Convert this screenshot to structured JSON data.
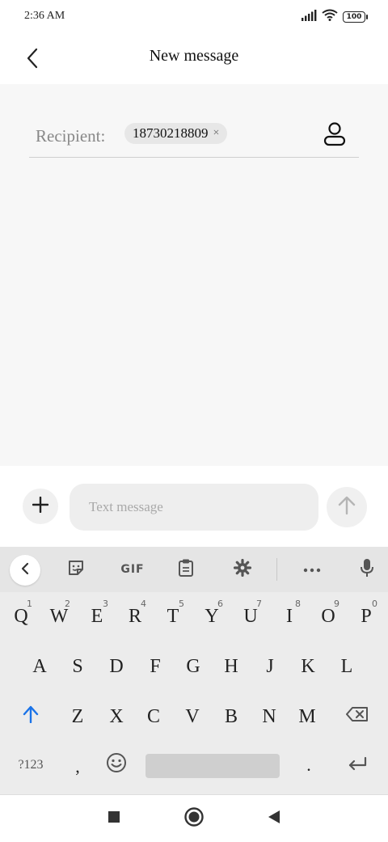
{
  "status_bar": {
    "time": "2:36 AM",
    "battery": "100"
  },
  "header": {
    "title": "New message"
  },
  "recipient": {
    "label": "Recipient:",
    "chips": [
      "18730218809"
    ],
    "remove_glyph": "×"
  },
  "compose": {
    "placeholder": "Text message",
    "value": ""
  },
  "keyboard": {
    "toolbar": {
      "gif_label": "GIF"
    },
    "row1": [
      {
        "key": "Q",
        "hint": "1"
      },
      {
        "key": "W",
        "hint": "2"
      },
      {
        "key": "E",
        "hint": "3"
      },
      {
        "key": "R",
        "hint": "4"
      },
      {
        "key": "T",
        "hint": "5"
      },
      {
        "key": "Y",
        "hint": "6"
      },
      {
        "key": "U",
        "hint": "7"
      },
      {
        "key": "I",
        "hint": "8"
      },
      {
        "key": "O",
        "hint": "9"
      },
      {
        "key": "P",
        "hint": "0"
      }
    ],
    "row2": [
      "A",
      "S",
      "D",
      "F",
      "G",
      "H",
      "J",
      "K",
      "L"
    ],
    "row3": [
      "Z",
      "X",
      "C",
      "V",
      "B",
      "N",
      "M"
    ],
    "symbols_key": "?123",
    "comma_key": ",",
    "period_key": ".",
    "shift_color": "#1a73e8"
  },
  "icons": {
    "back": "chevron-left-icon",
    "contact": "person-icon",
    "attach": "plus-icon",
    "send": "arrow-up-icon",
    "sticker": "sticker-icon",
    "clipboard": "clipboard-icon",
    "settings": "gear-icon",
    "more": "more-icon",
    "mic": "microphone-icon",
    "shift": "shift-icon",
    "backspace": "backspace-icon",
    "emoji": "emoji-icon",
    "enter": "enter-icon",
    "recents": "square-icon",
    "home": "circle-icon",
    "nav_back": "triangle-back-icon"
  }
}
